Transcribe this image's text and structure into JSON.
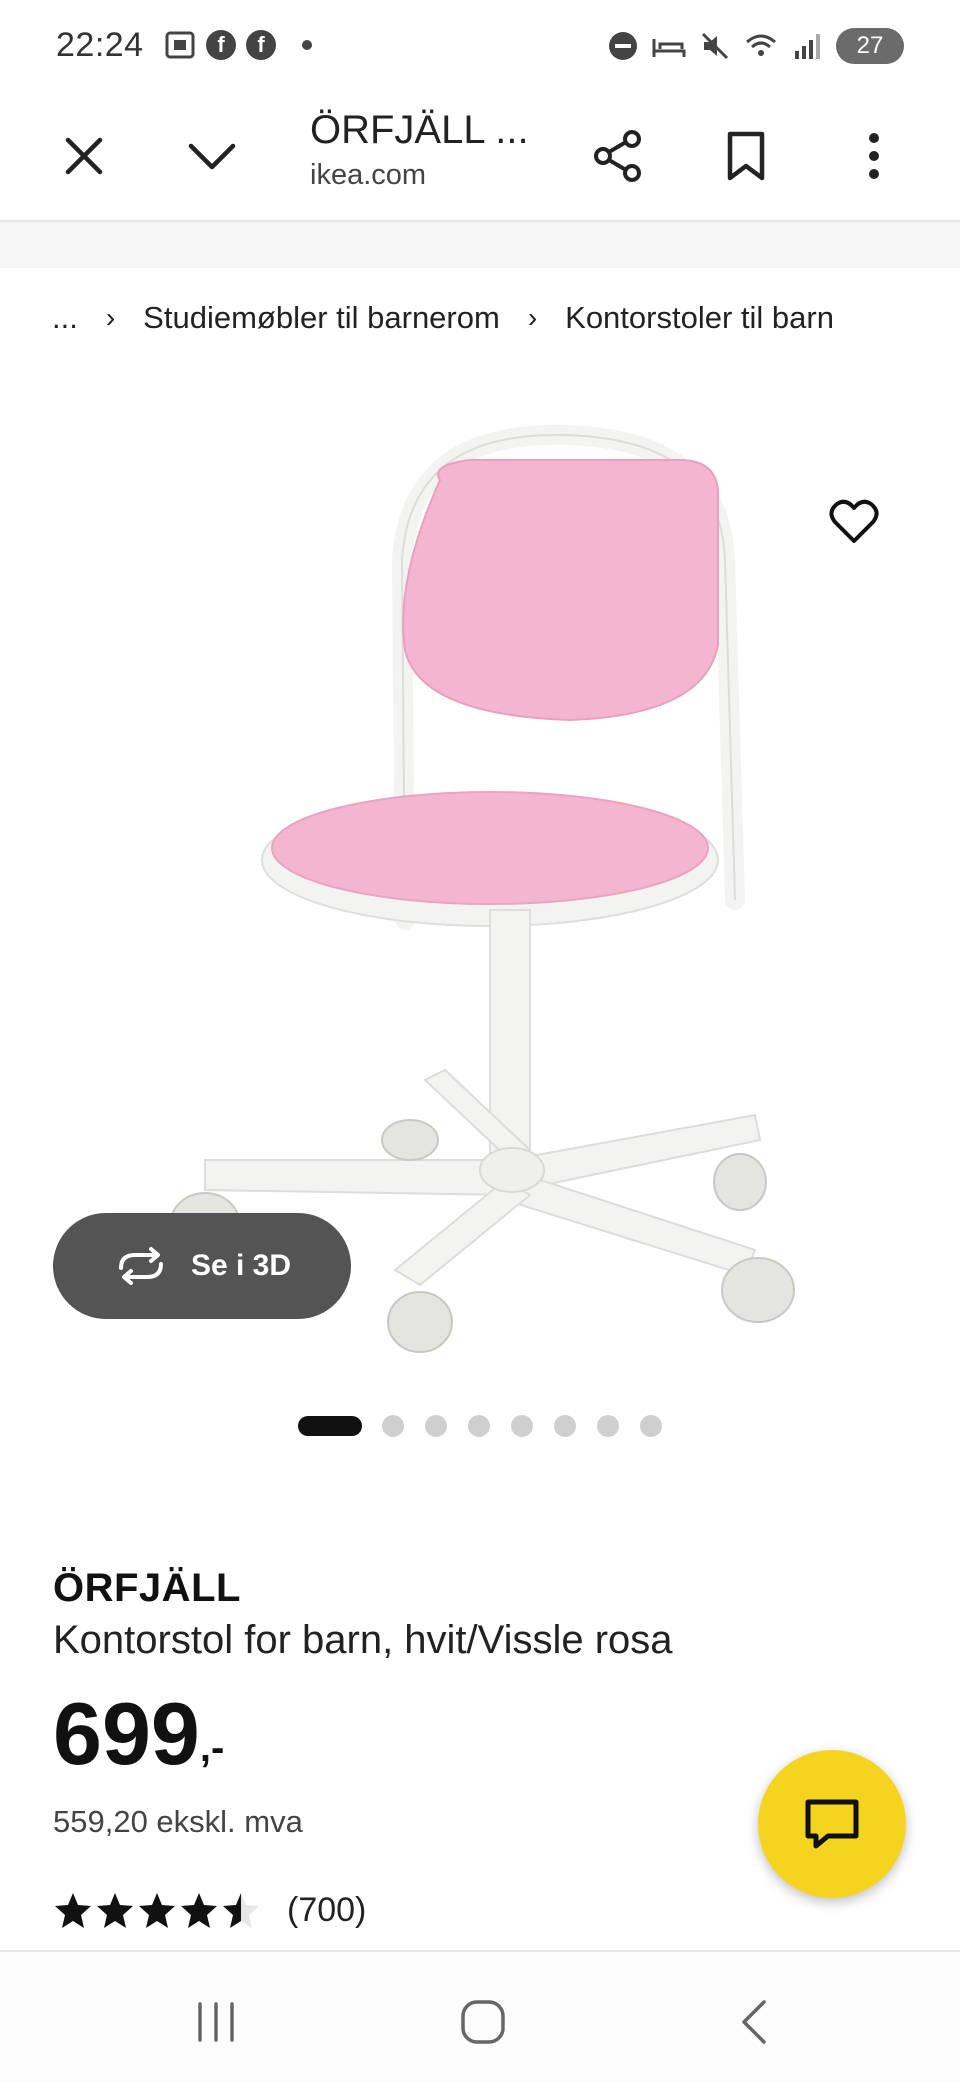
{
  "status_bar": {
    "time": "22:24",
    "left_icons": [
      "screenshot-icon",
      "facebook-icon",
      "facebook-icon",
      "notification-dot"
    ],
    "right_icons": [
      "do-not-disturb-icon",
      "sleep-mode-icon",
      "mute-icon",
      "wifi-icon",
      "signal-icon"
    ],
    "battery_level": "27"
  },
  "toolbar": {
    "title": "ÖRFJÄLL ...",
    "url": "ikea.com"
  },
  "breadcrumb": {
    "items": [
      "...",
      "Studiemøbler til barnerom",
      "Kontorstoler til barn"
    ]
  },
  "gallery": {
    "view_3d_label": "Se i 3D",
    "total_images": 8,
    "active_index": 0
  },
  "product": {
    "name": "ÖRFJÄLL",
    "description": "Kontorstol for barn, hvit/Vissle rosa",
    "price": "699",
    "price_suffix": ",-",
    "price_ex_vat": "559,20 ekskl. mva",
    "rating": 4.5,
    "rating_max": 5,
    "review_count": "(700)"
  },
  "colors": {
    "chat_button": "#f5d41f",
    "view_3d_button": "#545454",
    "chair_pink": "#f4b5cf",
    "chair_white": "#f3f3f1"
  }
}
